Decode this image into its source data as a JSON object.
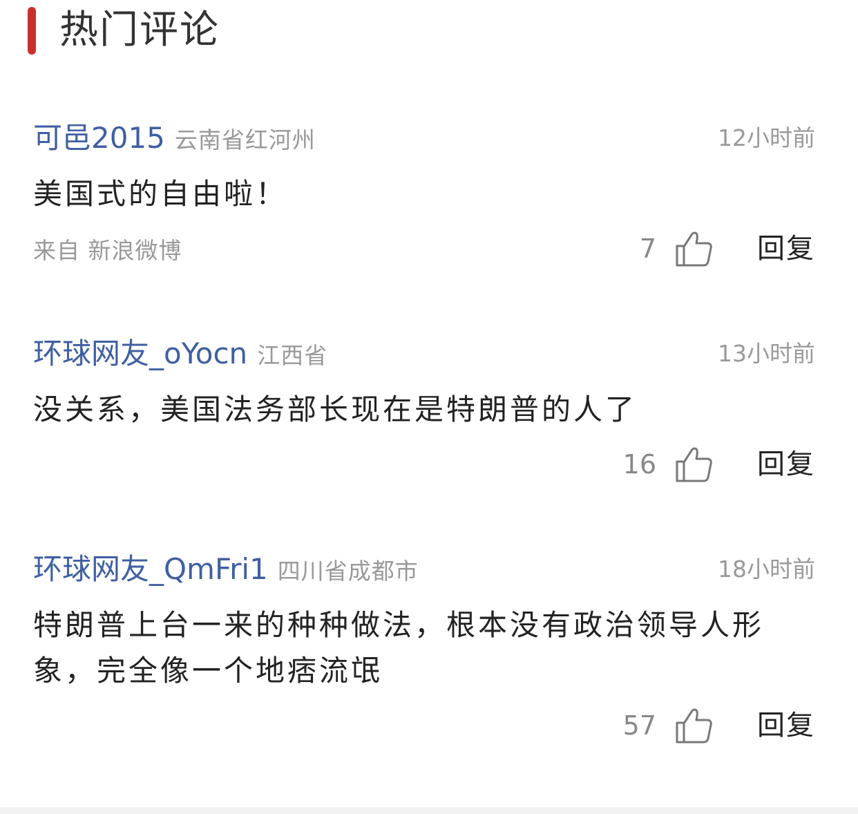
{
  "section": {
    "title": "热门评论",
    "accent_color": "#c9302c"
  },
  "colors": {
    "username": "#3f5fa2",
    "meta": "#999999",
    "content": "#222222"
  },
  "comments": [
    {
      "username": "可邑2015",
      "location": "云南省红河州",
      "time": "12小时前",
      "content": "美国式的自由啦！",
      "source": "来自 新浪微博",
      "likes": "7",
      "reply_label": "回复",
      "like_icon": "thumbs-up-icon"
    },
    {
      "username": "环球网友_oYocn",
      "location": "江西省",
      "time": "13小时前",
      "content": "没关系，美国法务部长现在是特朗普的人了",
      "likes": "16",
      "reply_label": "回复",
      "like_icon": "thumbs-up-icon"
    },
    {
      "username": "环球网友_QmFri1",
      "location": "四川省成都市",
      "time": "18小时前",
      "content": "特朗普上台一来的种种做法，根本没有政治领导人形象，完全像一个地痞流氓",
      "likes": "57",
      "reply_label": "回复",
      "like_icon": "thumbs-up-icon"
    }
  ]
}
